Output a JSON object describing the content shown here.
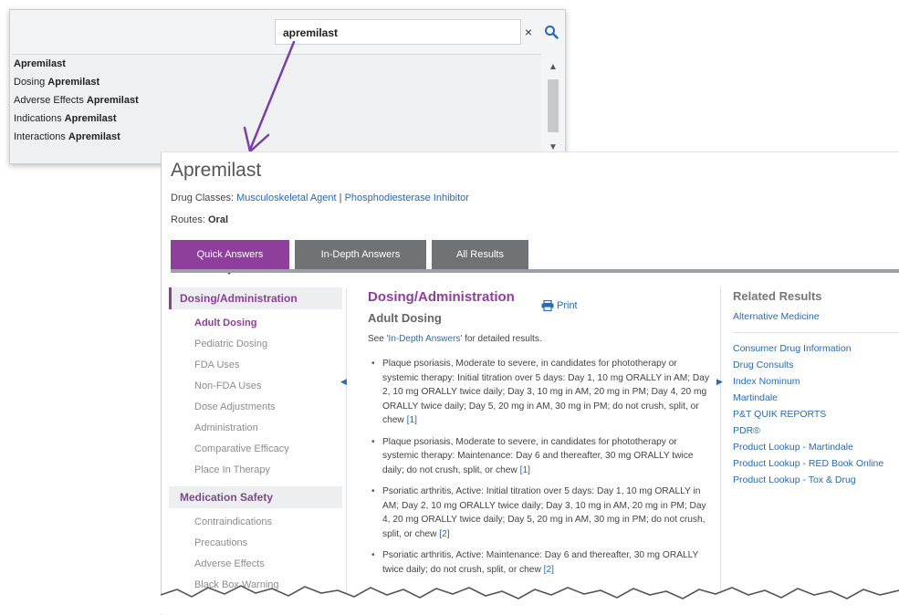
{
  "search": {
    "query": "apremilast",
    "clear_glyph": "×",
    "suggestions": [
      {
        "prefix": "",
        "term": "Apremilast"
      },
      {
        "prefix": "Dosing ",
        "term": "Apremilast"
      },
      {
        "prefix": "Adverse Effects ",
        "term": "Apremilast"
      },
      {
        "prefix": "Indications ",
        "term": "Apremilast"
      },
      {
        "prefix": "Interactions ",
        "term": "Apremilast"
      }
    ],
    "scroll_up": "▲",
    "scroll_down": "▼"
  },
  "drug": {
    "title": "Apremilast",
    "classes_label": "Drug Classes:",
    "classes": [
      "Musculoskeletal Agent",
      "Phosphodiesterase Inhibitor"
    ],
    "class_separator": "|",
    "routes_label": "Routes:",
    "routes": "Oral"
  },
  "tabs": [
    "Quick Answers",
    "In-Depth Answers",
    "All Results"
  ],
  "nav": {
    "sections": [
      {
        "label": "Dosing/Administration",
        "items": [
          "Adult Dosing",
          "Pediatric Dosing",
          "FDA Uses",
          "Non-FDA Uses",
          "Dose Adjustments",
          "Administration",
          "Comparative Efficacy",
          "Place In Therapy"
        ]
      },
      {
        "label": "Medication Safety",
        "items": [
          "Contraindications",
          "Precautions",
          "Adverse Effects",
          "Black Box Warning"
        ]
      }
    ]
  },
  "main": {
    "heading": "Dosing/Administration",
    "print": "Print",
    "subheading": "Adult Dosing",
    "see_prefix": "See ",
    "see_link": "'In-Depth Answers'",
    "see_suffix": " for detailed results.",
    "bullets": [
      {
        "text": "Plaque psoriasis, Moderate to severe, in candidates for phototherapy or systemic therapy: Initial titration over 5 days: Day 1, 10 mg ORALLY in AM; Day 2, 10 mg ORALLY twice daily; Day 3, 10 mg in AM, 20 mg in PM; Day 4, 20 mg ORALLY twice daily; Day 5, 20 mg in AM, 30 mg in PM; do not crush, split, or chew ",
        "ref": "[1]"
      },
      {
        "text": "Plaque psoriasis, Moderate to severe, in candidates for phototherapy or systemic therapy: Maintenance: Day 6 and thereafter, 30 mg ORALLY twice daily; do not crush, split, or chew ",
        "ref": "[1]"
      },
      {
        "text": "Psoriatic arthritis, Active: Initial titration over 5 days: Day 1, 10 mg ORALLY in AM; Day 2, 10 mg ORALLY twice daily; Day 3, 10 mg in AM, 20 mg in PM; Day 4, 20 mg ORALLY twice daily; Day 5, 20 mg in AM, 30 mg in PM; do not crush, split, or chew ",
        "ref": "[2]"
      },
      {
        "text": "Psoriatic arthritis, Active: Maintenance: Day 6 and thereafter, 30 mg ORALLY twice daily; do not crush, split, or chew ",
        "ref": "[2]"
      }
    ]
  },
  "related": {
    "heading": "Related Results",
    "group1": [
      "Alternative Medicine"
    ],
    "group2": [
      "Consumer Drug Information",
      "Drug Consults",
      "Index Nominum",
      "Martindale",
      "P&T QUIK REPORTS",
      "PDR®",
      "Product Lookup - Martindale",
      "Product Lookup - RED Book Online",
      "Product Lookup - Tox & Drug"
    ]
  },
  "colors": {
    "accent": "#8e3f9c",
    "link": "#2a6ab0",
    "tab_inactive": "#6f7376"
  }
}
